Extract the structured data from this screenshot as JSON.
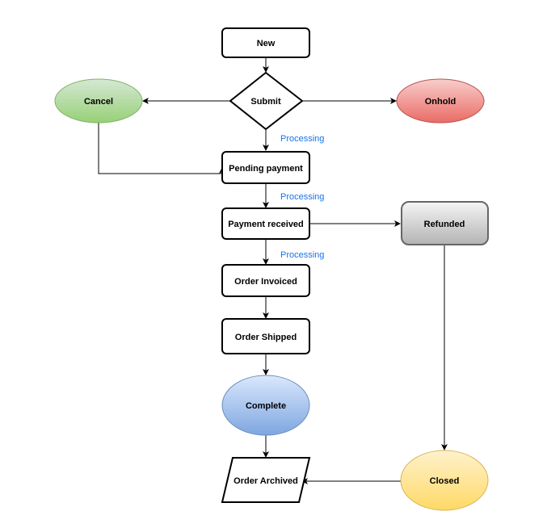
{
  "diagram": {
    "type": "flowchart",
    "nodes": {
      "new": {
        "label": "New",
        "shape": "rounded-rectangle"
      },
      "submit": {
        "label": "Submit",
        "shape": "diamond"
      },
      "cancel": {
        "label": "Cancel",
        "shape": "ellipse",
        "color": "#a9d18e"
      },
      "onhold": {
        "label": "Onhold",
        "shape": "ellipse",
        "color": "#ea6b66"
      },
      "pending_payment": {
        "label": "Pending payment",
        "shape": "rounded-rectangle"
      },
      "payment_received": {
        "label": "Payment received",
        "shape": "rounded-rectangle"
      },
      "refunded": {
        "label": "Refunded",
        "shape": "rounded-rectangle",
        "color": "#cccccc"
      },
      "order_invoiced": {
        "label": "Order Invoiced",
        "shape": "rounded-rectangle"
      },
      "order_shipped": {
        "label": "Order Shipped",
        "shape": "rounded-rectangle"
      },
      "complete": {
        "label": "Complete",
        "shape": "ellipse",
        "color": "#7ea6e0"
      },
      "order_archived": {
        "label": "Order Archived",
        "shape": "parallelogram"
      },
      "closed": {
        "label": "Closed",
        "shape": "ellipse",
        "color": "#ffd966"
      }
    },
    "edges": [
      {
        "from": "new",
        "to": "submit",
        "label": ""
      },
      {
        "from": "submit",
        "to": "cancel",
        "label": ""
      },
      {
        "from": "submit",
        "to": "onhold",
        "label": ""
      },
      {
        "from": "submit",
        "to": "pending_payment",
        "label": "Processing"
      },
      {
        "from": "cancel",
        "to": "pending_payment",
        "label": ""
      },
      {
        "from": "pending_payment",
        "to": "payment_received",
        "label": "Processing"
      },
      {
        "from": "payment_received",
        "to": "refunded",
        "label": ""
      },
      {
        "from": "payment_received",
        "to": "order_invoiced",
        "label": "Processing"
      },
      {
        "from": "order_invoiced",
        "to": "order_shipped",
        "label": ""
      },
      {
        "from": "order_shipped",
        "to": "complete",
        "label": ""
      },
      {
        "from": "complete",
        "to": "order_archived",
        "label": ""
      },
      {
        "from": "refunded",
        "to": "closed",
        "label": ""
      },
      {
        "from": "closed",
        "to": "order_archived",
        "label": ""
      }
    ],
    "edge_labels": {
      "submit_to_pending": "Processing",
      "pending_to_received": "Processing",
      "received_to_invoiced": "Processing"
    }
  }
}
